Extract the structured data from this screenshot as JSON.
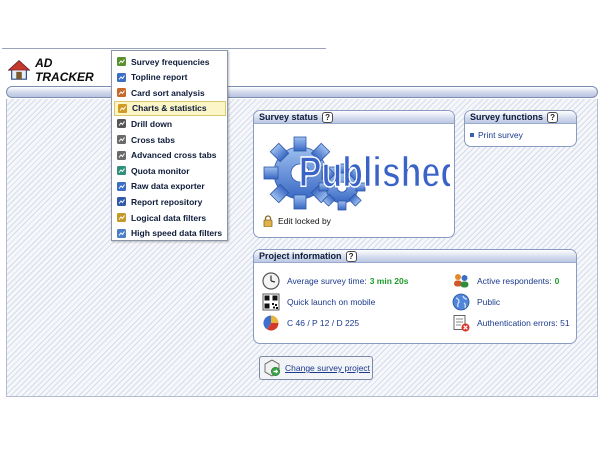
{
  "app": {
    "title": "AD TRACKER"
  },
  "menu": {
    "items": [
      {
        "label": "Survey frequencies",
        "icon": "frequency-chart-icon",
        "active": false
      },
      {
        "label": "Topline report",
        "icon": "topline-report-icon",
        "active": false
      },
      {
        "label": "Card sort analysis",
        "icon": "card-sort-icon",
        "active": false
      },
      {
        "label": "Charts & statistics",
        "icon": "charts-icon",
        "active": true
      },
      {
        "label": "Drill down",
        "icon": "drill-down-icon",
        "active": false
      },
      {
        "label": "Cross tabs",
        "icon": "cross-tabs-icon",
        "active": false
      },
      {
        "label": "Advanced cross tabs",
        "icon": "advanced-cross-tabs-icon",
        "active": false
      },
      {
        "label": "Quota monitor",
        "icon": "quota-monitor-icon",
        "active": false
      },
      {
        "label": "Raw data exporter",
        "icon": "raw-data-exporter-icon",
        "active": false
      },
      {
        "label": "Report repository",
        "icon": "report-repository-icon",
        "active": false
      },
      {
        "label": "Logical data filters",
        "icon": "logical-filter-icon",
        "active": false
      },
      {
        "label": "High speed data filters",
        "icon": "high-speed-filter-icon",
        "active": false
      }
    ]
  },
  "survey_status": {
    "title": "Survey status",
    "help": "?",
    "badge_text": "Published",
    "edit_locked_label": "Edit locked by"
  },
  "survey_functions": {
    "title": "Survey functions",
    "help": "?",
    "links": [
      "Print survey"
    ]
  },
  "project_info": {
    "title": "Project information",
    "help": "?",
    "avg_time_label": "Average survey time:",
    "avg_time_value": "3 min 20s",
    "active_label": "Active respondents:",
    "active_value": "0",
    "quick_launch": "Quick launch on mobile",
    "visibility": "Public",
    "counts": "C 46 / P 12 / D 225",
    "auth_errors": "Authentication errors: 51"
  },
  "change_button": {
    "label": "Change survey project"
  },
  "colors": {
    "accent": "#1b3a8c",
    "value_green": "#1e9c2a",
    "badge_blue": "#3a63c8",
    "gear_blue": "#4d7fd0"
  }
}
